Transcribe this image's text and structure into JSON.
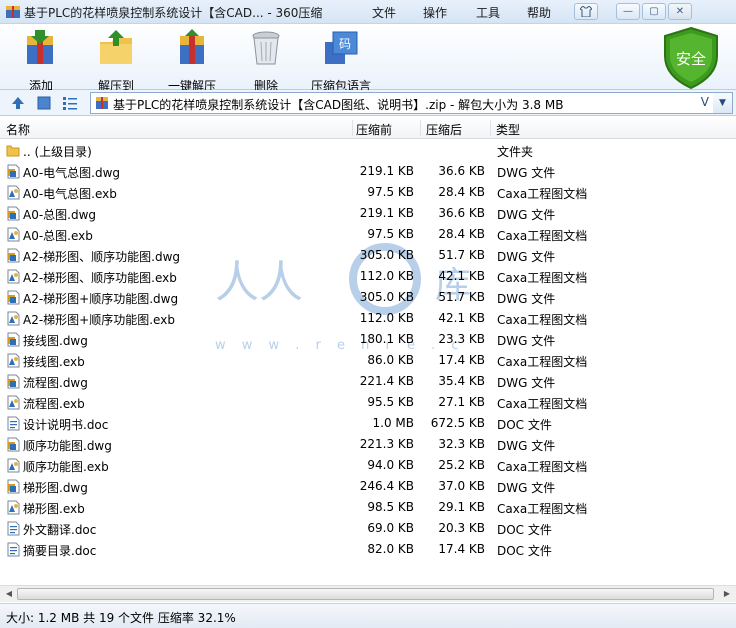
{
  "window": {
    "title": "基于PLC的花样喷泉控制系统设计【含CAD... - 360压缩",
    "menu": [
      "文件",
      "操作",
      "工具",
      "帮助"
    ],
    "icon": "archive-icon"
  },
  "toolbar": {
    "buttons": [
      {
        "label": "添加",
        "icon": "add-archive-icon"
      },
      {
        "label": "解压到",
        "icon": "extract-to-icon"
      },
      {
        "label": "一键解压",
        "icon": "one-click-extract-icon"
      },
      {
        "label": "删除",
        "icon": "delete-trash-icon"
      },
      {
        "label": "压缩包语言",
        "icon": "language-icon"
      }
    ],
    "security_badge": "安全"
  },
  "address": {
    "path": "基于PLC的花样喷泉控制系统设计【含CAD图纸、说明书】.zip - 解包大小为 3.8 MB"
  },
  "columns": {
    "name": "名称",
    "original": "压缩前",
    "compressed": "压缩后",
    "type": "类型"
  },
  "files": [
    {
      "name": ".. (上级目录)",
      "original": "",
      "compressed": "",
      "type": "文件夹",
      "kind": "folder"
    },
    {
      "name": "A0-电气总图.dwg",
      "original": "219.1 KB",
      "compressed": "36.6 KB",
      "type": "DWG 文件",
      "kind": "dwg"
    },
    {
      "name": "A0-电气总图.exb",
      "original": "97.5 KB",
      "compressed": "28.4 KB",
      "type": "Caxa工程图文档",
      "kind": "exb"
    },
    {
      "name": "A0-总图.dwg",
      "original": "219.1 KB",
      "compressed": "36.6 KB",
      "type": "DWG 文件",
      "kind": "dwg"
    },
    {
      "name": "A0-总图.exb",
      "original": "97.5 KB",
      "compressed": "28.4 KB",
      "type": "Caxa工程图文档",
      "kind": "exb"
    },
    {
      "name": "A2-梯形图、顺序功能图.dwg",
      "original": "305.0 KB",
      "compressed": "51.7 KB",
      "type": "DWG 文件",
      "kind": "dwg"
    },
    {
      "name": "A2-梯形图、顺序功能图.exb",
      "original": "112.0 KB",
      "compressed": "42.1 KB",
      "type": "Caxa工程图文档",
      "kind": "exb"
    },
    {
      "name": "A2-梯形图+顺序功能图.dwg",
      "original": "305.0 KB",
      "compressed": "51.7 KB",
      "type": "DWG 文件",
      "kind": "dwg"
    },
    {
      "name": "A2-梯形图+顺序功能图.exb",
      "original": "112.0 KB",
      "compressed": "42.1 KB",
      "type": "Caxa工程图文档",
      "kind": "exb"
    },
    {
      "name": "接线图.dwg",
      "original": "180.1 KB",
      "compressed": "23.3 KB",
      "type": "DWG 文件",
      "kind": "dwg"
    },
    {
      "name": "接线图.exb",
      "original": "86.0 KB",
      "compressed": "17.4 KB",
      "type": "Caxa工程图文档",
      "kind": "exb"
    },
    {
      "name": "流程图.dwg",
      "original": "221.4 KB",
      "compressed": "35.4 KB",
      "type": "DWG 文件",
      "kind": "dwg"
    },
    {
      "name": "流程图.exb",
      "original": "95.5 KB",
      "compressed": "27.1 KB",
      "type": "Caxa工程图文档",
      "kind": "exb"
    },
    {
      "name": "设计说明书.doc",
      "original": "1.0 MB",
      "compressed": "672.5 KB",
      "type": "DOC 文件",
      "kind": "doc"
    },
    {
      "name": "顺序功能图.dwg",
      "original": "221.3 KB",
      "compressed": "32.3 KB",
      "type": "DWG 文件",
      "kind": "dwg"
    },
    {
      "name": "顺序功能图.exb",
      "original": "94.0 KB",
      "compressed": "25.2 KB",
      "type": "Caxa工程图文档",
      "kind": "exb"
    },
    {
      "name": "梯形图.dwg",
      "original": "246.4 KB",
      "compressed": "37.0 KB",
      "type": "DWG 文件",
      "kind": "dwg"
    },
    {
      "name": "梯形图.exb",
      "original": "98.5 KB",
      "compressed": "29.1 KB",
      "type": "Caxa工程图文档",
      "kind": "exb"
    },
    {
      "name": "外文翻译.doc",
      "original": "69.0 KB",
      "compressed": "20.3 KB",
      "type": "DOC 文件",
      "kind": "doc"
    },
    {
      "name": "摘要目录.doc",
      "original": "82.0 KB",
      "compressed": "17.4 KB",
      "type": "DOC 文件",
      "kind": "doc"
    }
  ],
  "status": "大小: 1.2 MB 共 19 个文件 压缩率 32.1%",
  "colors": {
    "accent": "#2f6fb7",
    "security": "#3c9a1e",
    "titlebar": "#dbe8f6"
  }
}
